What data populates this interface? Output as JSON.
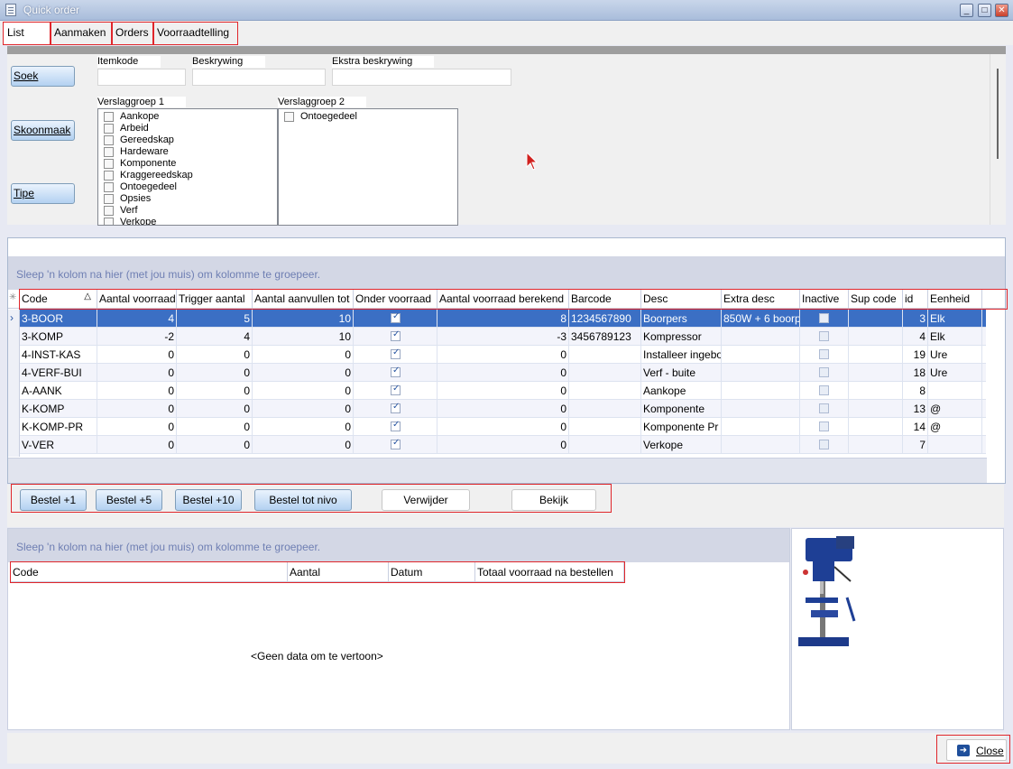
{
  "window": {
    "title": "Quick order",
    "min_glyph": "_",
    "max_glyph": "□",
    "close_glyph": "✕"
  },
  "tabs": [
    "List",
    "Aanmaken",
    "Orders",
    "Voorraadtelling"
  ],
  "search": {
    "buttons": [
      "Soek",
      "Skoonmaak",
      "Tipe"
    ],
    "fields": [
      "Itemkode",
      "Beskrywing",
      "Ekstra beskrywing"
    ],
    "group1": {
      "label": "Verslaggroep 1",
      "items": [
        "Aankope",
        "Arbeid",
        "Gereedskap",
        "Hardeware",
        "Komponente",
        "Kraggereedskap",
        "Ontoegedeel",
        "Opsies",
        "Verf",
        "Verkope"
      ]
    },
    "group2": {
      "label": "Verslaggroep 2",
      "items": [
        "Ontoegedeel"
      ]
    }
  },
  "grid": {
    "group_hint": "Sleep 'n kolom na hier (met jou muis) om kolomme te groepeer.",
    "new_row_glyph": "✳",
    "sort_glyph": "△",
    "current_row_glyph": "›",
    "columns": [
      "Code",
      "Aantal voorraad",
      "Trigger aantal",
      "Aantal aanvullen tot",
      "Onder voorraad",
      "Aantal voorraad berekend",
      "Barcode",
      "Desc",
      "Extra desc",
      "Inactive",
      "Sup code",
      "id",
      "Eenheid"
    ],
    "rows": [
      {
        "code": "3-BOOR",
        "aantal": "4",
        "trigger": "5",
        "aanvul": "10",
        "onder": true,
        "berekend": "8",
        "barcode": "1234567890",
        "desc": "Boorpers",
        "extra": "850W + 6 boorp",
        "inactive": false,
        "sup": "",
        "id": "3",
        "eenheid": "Elk"
      },
      {
        "code": "3-KOMP",
        "aantal": "-2",
        "trigger": "4",
        "aanvul": "10",
        "onder": true,
        "berekend": "-3",
        "barcode": "3456789123",
        "desc": "Kompressor",
        "extra": "",
        "inactive": false,
        "sup": "",
        "id": "4",
        "eenheid": "Elk"
      },
      {
        "code": "4-INST-KAS",
        "aantal": "0",
        "trigger": "0",
        "aanvul": "0",
        "onder": true,
        "berekend": "0",
        "barcode": "",
        "desc": "Installeer ingebo",
        "extra": "",
        "inactive": false,
        "sup": "",
        "id": "19",
        "eenheid": "Ure"
      },
      {
        "code": "4-VERF-BUI",
        "aantal": "0",
        "trigger": "0",
        "aanvul": "0",
        "onder": true,
        "berekend": "0",
        "barcode": "",
        "desc": "Verf - buite",
        "extra": "",
        "inactive": false,
        "sup": "",
        "id": "18",
        "eenheid": "Ure"
      },
      {
        "code": "A-AANK",
        "aantal": "0",
        "trigger": "0",
        "aanvul": "0",
        "onder": true,
        "berekend": "0",
        "barcode": "",
        "desc": "Aankope",
        "extra": "",
        "inactive": false,
        "sup": "",
        "id": "8",
        "eenheid": ""
      },
      {
        "code": "K-KOMP",
        "aantal": "0",
        "trigger": "0",
        "aanvul": "0",
        "onder": true,
        "berekend": "0",
        "barcode": "",
        "desc": "Komponente",
        "extra": "",
        "inactive": false,
        "sup": "",
        "id": "13",
        "eenheid": "@"
      },
      {
        "code": "K-KOMP-PR",
        "aantal": "0",
        "trigger": "0",
        "aanvul": "0",
        "onder": true,
        "berekend": "0",
        "barcode": "",
        "desc": "Komponente Pr",
        "extra": "",
        "inactive": false,
        "sup": "",
        "id": "14",
        "eenheid": "@"
      },
      {
        "code": "V-VER",
        "aantal": "0",
        "trigger": "0",
        "aanvul": "0",
        "onder": true,
        "berekend": "0",
        "barcode": "",
        "desc": "Verkope",
        "extra": "",
        "inactive": false,
        "sup": "",
        "id": "7",
        "eenheid": ""
      }
    ]
  },
  "actions": [
    "Bestel +1",
    "Bestel +5",
    "Bestel +10",
    "Bestel tot nivo",
    "Verwijder",
    "Bekijk"
  ],
  "lower": {
    "group_hint": "Sleep 'n kolom na hier (met jou muis) om kolomme te groepeer.",
    "columns": [
      "Code",
      "Aantal",
      "Datum",
      "Totaal voorraad na bestellen"
    ],
    "empty_text": "<Geen data om te vertoon>"
  },
  "close": {
    "label": "Close",
    "icon_glyph": "➜"
  },
  "colors": {
    "selection": "#3b6fc4",
    "highlight": "#e0262b",
    "group_hint": "#6f7fb3"
  }
}
